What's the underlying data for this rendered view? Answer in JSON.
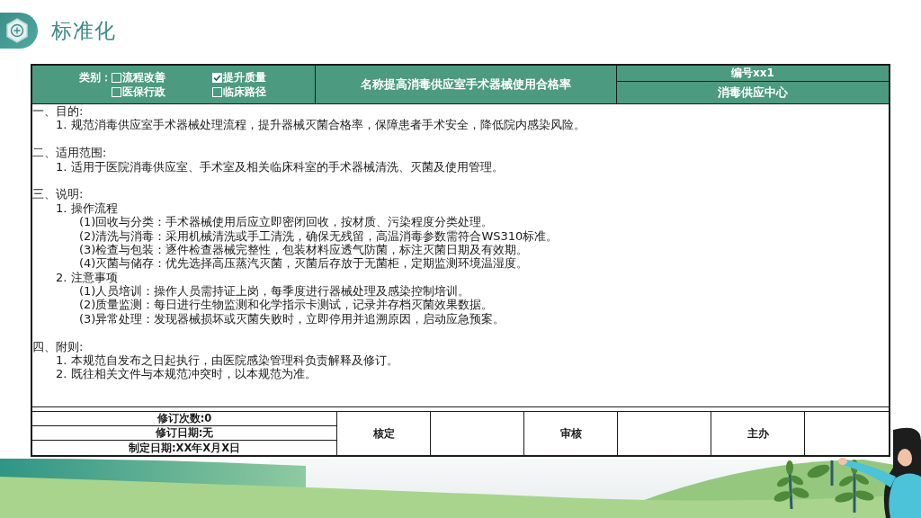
{
  "title": "标准化",
  "header": {
    "category": {
      "label": "类别：",
      "options": [
        {
          "label": "流程改善",
          "checked": false
        },
        {
          "label": "提升质量",
          "checked": true
        },
        {
          "label": "医保行政",
          "checked": false
        },
        {
          "label": "临床路径",
          "checked": false
        }
      ]
    },
    "name": "名称提高消毒供应室手术器械使用合格率",
    "number": "编号xx1",
    "department": "消毒供应中心"
  },
  "sections": [
    {
      "heading": "一、目的:",
      "items": [
        {
          "text": "1. 规范消毒供应室手术器械处理流程，提升器械灭菌合格率，保障患者手术安全，降低院内感染风险。"
        }
      ]
    },
    {
      "heading": "二、适用范围:",
      "items": [
        {
          "text": "1. 适用于医院消毒供应室、手术室及相关临床科室的手术器械清洗、灭菌及使用管理。"
        }
      ]
    },
    {
      "heading": "三、说明:",
      "items": [
        {
          "text": "1. 操作流程",
          "children": [
            {
              "text": "(1)回收与分类：手术器械使用后应立即密闭回收，按材质、污染程度分类处理。"
            },
            {
              "text": "(2)清洗与消毒：采用机械清洗或手工清洗，确保无残留，高温消毒参数需符合WS310标准。"
            },
            {
              "text": "(3)检查与包装：逐件检查器械完整性，包装材料应透气防菌，标注灭菌日期及有效期。"
            },
            {
              "text": "(4)灭菌与储存：优先选择高压蒸汽灭菌，灭菌后存放于无菌柜，定期监测环境温湿度。"
            }
          ]
        },
        {
          "text": "2. 注意事项",
          "children": [
            {
              "text": "(1)人员培训：操作人员需持证上岗，每季度进行器械处理及感染控制培训。"
            },
            {
              "text": "(2)质量监测：每日进行生物监测和化学指示卡测试，记录并存档灭菌效果数据。"
            },
            {
              "text": "(3)异常处理：发现器械损坏或灭菌失败时，立即停用并追溯原因，启动应急预案。"
            }
          ]
        }
      ]
    },
    {
      "heading": "四、附则:",
      "items": [
        {
          "text": "1. 本规范自发布之日起执行，由医院感染管理科负责解释及修订。"
        },
        {
          "text": "2. 既往相关文件与本规范冲突时，以本规范为准。"
        }
      ]
    }
  ],
  "footer": {
    "records": [
      "修订次数:0",
      "修订日期:无",
      "制定日期:XX年X月X日"
    ],
    "signoffs": [
      "核定",
      "审核",
      "主办"
    ]
  }
}
